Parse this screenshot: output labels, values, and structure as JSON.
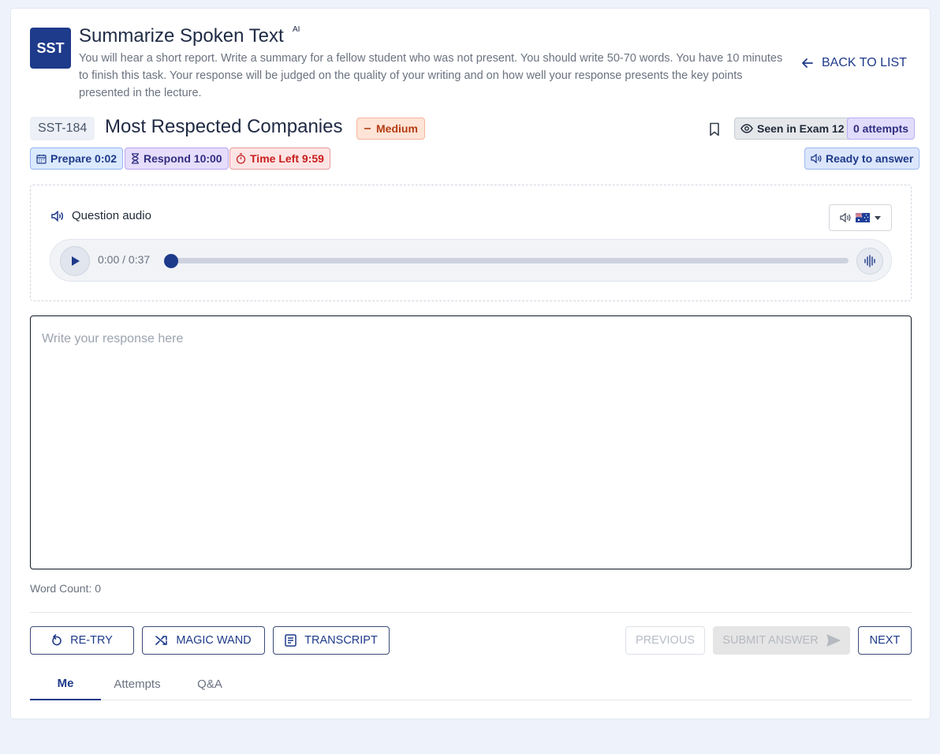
{
  "task": {
    "logo": "SST",
    "title": "Summarize Spoken Text",
    "title_badge": "AI",
    "instructions": "You will hear a short report. Write a summary for a fellow student who was not present. You should write 50-70 words. You have 10 minutes to finish this task. Your response will be judged on the quality of your writing and on how well your response presents the key points presented in the lecture.",
    "back_label": "BACK TO LIST"
  },
  "question": {
    "id": "SST-184",
    "title": "Most Respected Companies",
    "difficulty": "Medium",
    "seen_label": "Seen in Exam 12",
    "attempts_label": "0 attempts",
    "status_label": "Ready to answer"
  },
  "timers": {
    "prepare": "Prepare 0:02",
    "respond": "Respond 10:00",
    "time_left": "Time Left 9:59"
  },
  "audio": {
    "label": "Question audio",
    "time_display": "0:00 / 0:37",
    "progress": 0,
    "accent": "Australian"
  },
  "response": {
    "placeholder": "Write your response here",
    "value": "",
    "word_count_label": "Word Count: 0"
  },
  "actions": {
    "retry": "RE-TRY",
    "magic_wand": "MAGIC WAND",
    "transcript": "TRANSCRIPT",
    "previous": "PREVIOUS",
    "submit": "SUBMIT ANSWER",
    "next": "NEXT"
  },
  "tabs": [
    {
      "label": "Me",
      "active": true
    },
    {
      "label": "Attempts",
      "active": false
    },
    {
      "label": "Q&A",
      "active": false
    }
  ],
  "colors": {
    "primary": "#1e3a8a",
    "danger": "#c81e1e",
    "difficulty": "#b43c14"
  }
}
